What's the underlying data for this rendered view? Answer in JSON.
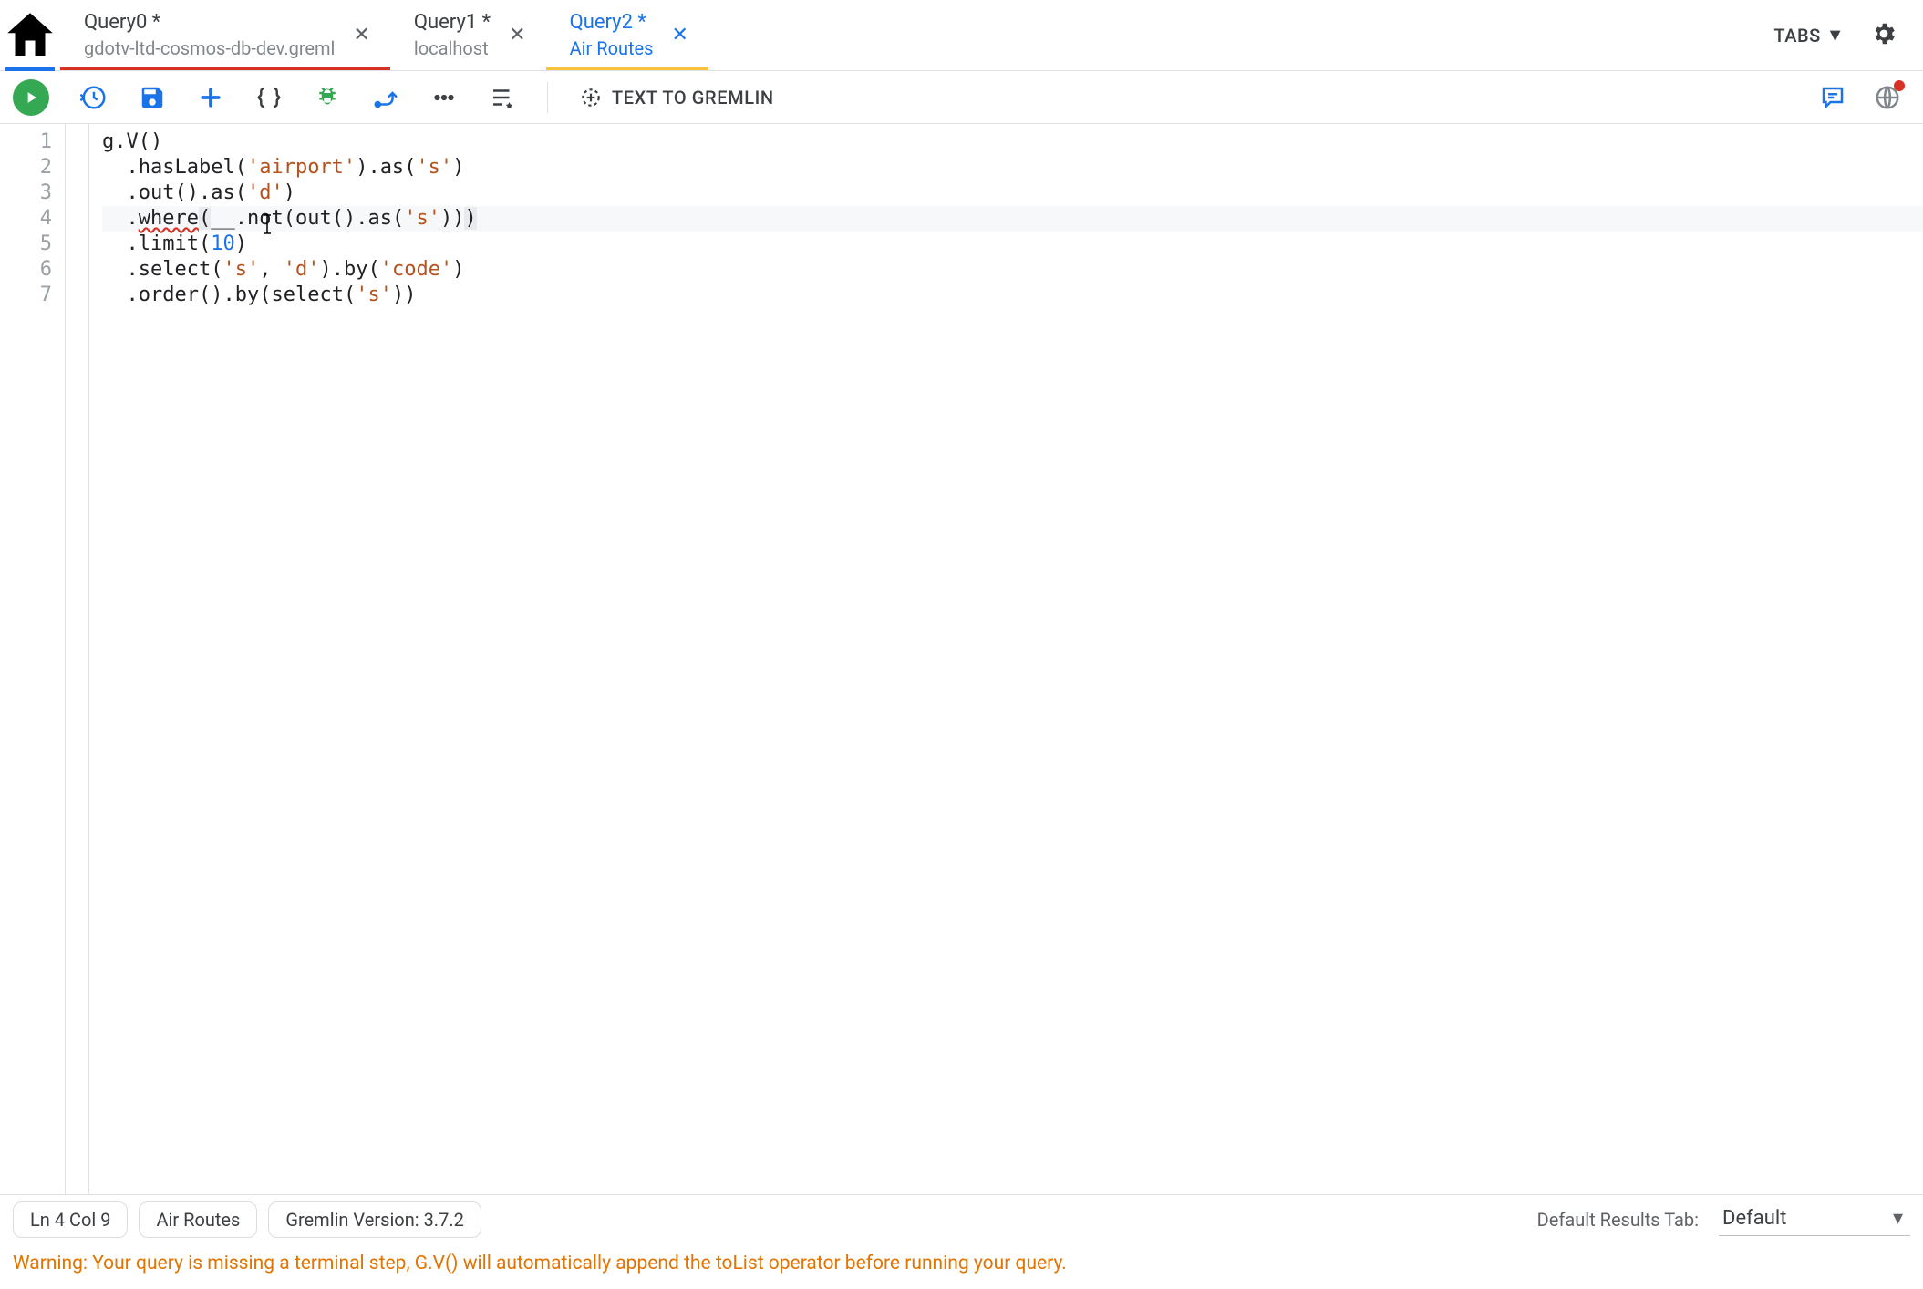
{
  "tabs": [
    {
      "title": "Query0 *",
      "subtitle": "gdotv-ltd-cosmos-db-dev.greml",
      "state": "red"
    },
    {
      "title": "Query1 *",
      "subtitle": "localhost",
      "state": "none"
    },
    {
      "title": "Query2 *",
      "subtitle": "Air Routes",
      "state": "active-yellow"
    }
  ],
  "tabs_menu_label": "TABS",
  "toolbar": {
    "text_to_gremlin": "TEXT TO GREMLIN"
  },
  "editor": {
    "line_numbers": [
      "1",
      "2",
      "3",
      "4",
      "5",
      "6",
      "7"
    ],
    "lines": {
      "l1": {
        "g": "g",
        "dot": ".",
        "V": "V",
        "op": "(",
        "cp": ")"
      },
      "l2": {
        "indent": "  .",
        "hasLabel": "hasLabel",
        "op": "(",
        "s1": "'airport'",
        "cp": ")",
        "dot2": ".",
        "as": "as",
        "op2": "(",
        "s2": "'s'",
        "cp2": ")"
      },
      "l3": {
        "indent": "  .",
        "out": "out",
        "op": "(",
        "cp": ")",
        "dot": ".",
        "as": "as",
        "op2": "(",
        "s": "'d'",
        "cp2": ")"
      },
      "l4": {
        "indent": "  .",
        "where": "where",
        "op": "(",
        "u": "__",
        "dot": ".",
        "not": "not",
        "op2": "(",
        "out": "out",
        "op3": "(",
        "cp3": ")",
        "dot2": ".",
        "as": "as",
        "op4": "(",
        "s": "'s'",
        "cp4": ")",
        "cp2": ")",
        "cp": ")"
      },
      "l5": {
        "indent": "  .",
        "limit": "limit",
        "op": "(",
        "n": "10",
        "cp": ")"
      },
      "l6": {
        "indent": "  .",
        "select": "select",
        "op": "(",
        "s1": "'s'",
        "comma": ", ",
        "s2": "'d'",
        "cp": ")",
        "dot": ".",
        "by": "by",
        "op2": "(",
        "s3": "'code'",
        "cp2": ")"
      },
      "l7": {
        "indent": "  .",
        "order": "order",
        "op": "(",
        "cp": ")",
        "dot": ".",
        "by": "by",
        "op2": "(",
        "select": "select",
        "op3": "(",
        "s": "'s'",
        "cp3": ")",
        "cp2": ")"
      }
    },
    "current_line": 4
  },
  "status": {
    "pos": "Ln 4 Col 9",
    "conn": "Air Routes",
    "version": "Gremlin Version: 3.7.2",
    "results_label": "Default Results Tab:",
    "results_value": "Default"
  },
  "warning": "Warning: Your query is missing a terminal step, G.V() will automatically append the toList operator before running your query."
}
